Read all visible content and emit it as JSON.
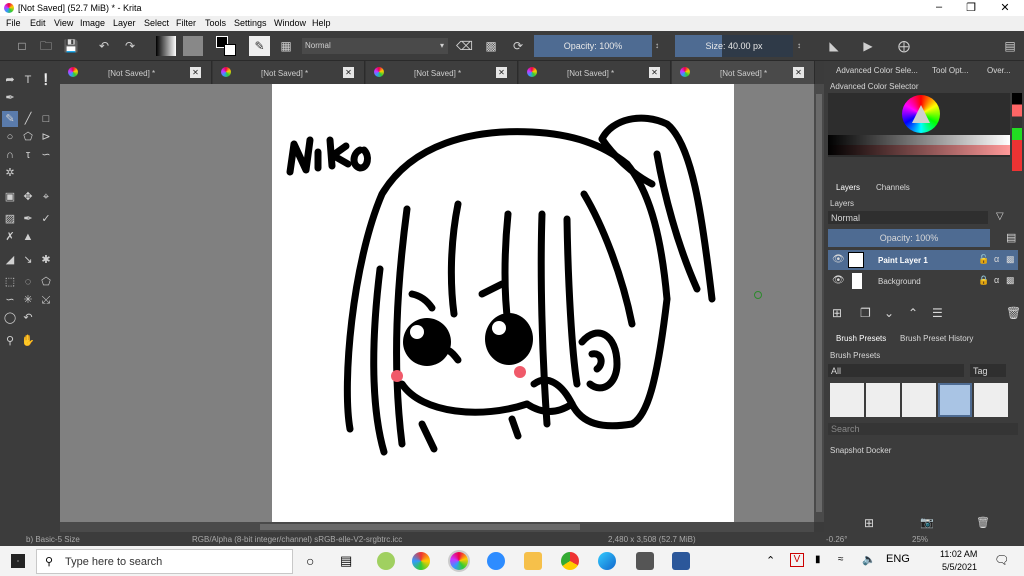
{
  "window": {
    "title": "[Not Saved]  (52.7 MiB)  * - Krita"
  },
  "menu": [
    "File",
    "Edit",
    "View",
    "Image",
    "Layer",
    "Select",
    "Filter",
    "Tools",
    "Settings",
    "Window",
    "Help"
  ],
  "toolbar": {
    "blend_mode": "Normal",
    "opacity": "Opacity: 100%",
    "size": "Size: 40.00 px"
  },
  "tabs": [
    {
      "label": "[Not Saved]  *"
    },
    {
      "label": "[Not Saved]  *"
    },
    {
      "label": "[Not Saved]  *"
    },
    {
      "label": "[Not Saved]  *"
    },
    {
      "label": "[Not Saved]  *"
    }
  ],
  "dock": {
    "top_tabs": [
      "Advanced Color Sele...",
      "Tool Opt...",
      "Over..."
    ],
    "color_selector_title": "Advanced Color Selector",
    "layer_tabs": [
      "Layers",
      "Channels"
    ],
    "layers_title": "Layers",
    "layer_blend": "Normal",
    "layer_opacity": "Opacity:  100%",
    "layers": [
      {
        "name": "Paint Layer 1"
      },
      {
        "name": "Background"
      }
    ],
    "brush_tabs": [
      "Brush Presets",
      "Brush Preset History"
    ],
    "brush_title": "Brush Presets",
    "brush_filter": "All",
    "brush_tag": "Tag",
    "brush_search_placeholder": "Search",
    "snapshot_title": "Snapshot Docker"
  },
  "status": {
    "brush": "b) Basic-5 Size",
    "color": "RGB/Alpha (8-bit integer/channel)  sRGB-elle-V2-srgbtrc.icc",
    "dims": "2,480 x 3,508 (52.7 MiB)",
    "rotation": "-0.26°",
    "zoom": "25%"
  },
  "canvas": {
    "signature": "NiKo"
  },
  "taskbar": {
    "search_placeholder": "Type here to search",
    "lang": "ENG",
    "time": "11:02 AM",
    "date": "5/5/2021"
  }
}
